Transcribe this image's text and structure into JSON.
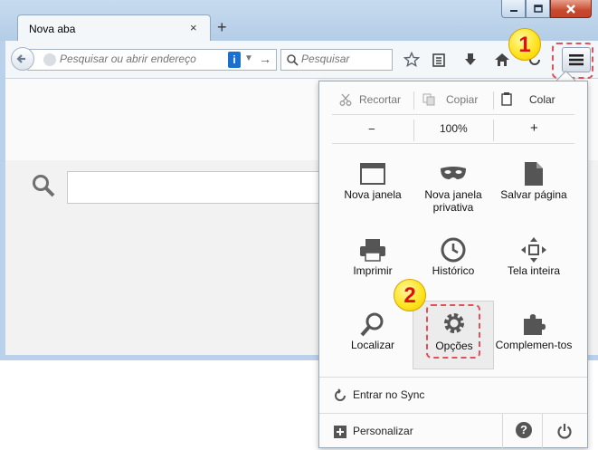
{
  "browser": {
    "tab": {
      "title": "Nova aba",
      "close": "×"
    },
    "new_tab": "+",
    "url": {
      "placeholder": "Pesquisar ou abrir endereço",
      "info_badge": "i"
    },
    "search": {
      "placeholder": "Pesquisar"
    }
  },
  "window_controls": [
    "minimize",
    "maximize",
    "close"
  ],
  "markers": {
    "one": "1",
    "two": "2"
  },
  "menu": {
    "edit": {
      "cut": "Recortar",
      "copy": "Copiar",
      "paste": "Colar"
    },
    "zoom": {
      "out": "−",
      "level": "100%",
      "in": "+"
    },
    "items": [
      {
        "label": "Nova janela",
        "icon": "window-icon"
      },
      {
        "label": "Nova janela privativa",
        "icon": "mask-icon"
      },
      {
        "label": "Salvar página",
        "icon": "page-icon"
      },
      {
        "label": "Imprimir",
        "icon": "printer-icon"
      },
      {
        "label": "Histórico",
        "icon": "clock-icon"
      },
      {
        "label": "Tela inteira",
        "icon": "fullscreen-icon"
      },
      {
        "label": "Localizar",
        "icon": "magnifier-icon"
      },
      {
        "label": "Opções",
        "icon": "gear-icon"
      },
      {
        "label": "Complemen-tos",
        "icon": "puzzle-icon"
      }
    ],
    "sync": "Entrar no Sync",
    "customize": "Personalizar",
    "help": "?",
    "quit": "power"
  },
  "colors": {
    "accent_blue": "#1b6fcf",
    "highlight_red": "#e2505a",
    "marker_yellow": "#ffe21a"
  }
}
